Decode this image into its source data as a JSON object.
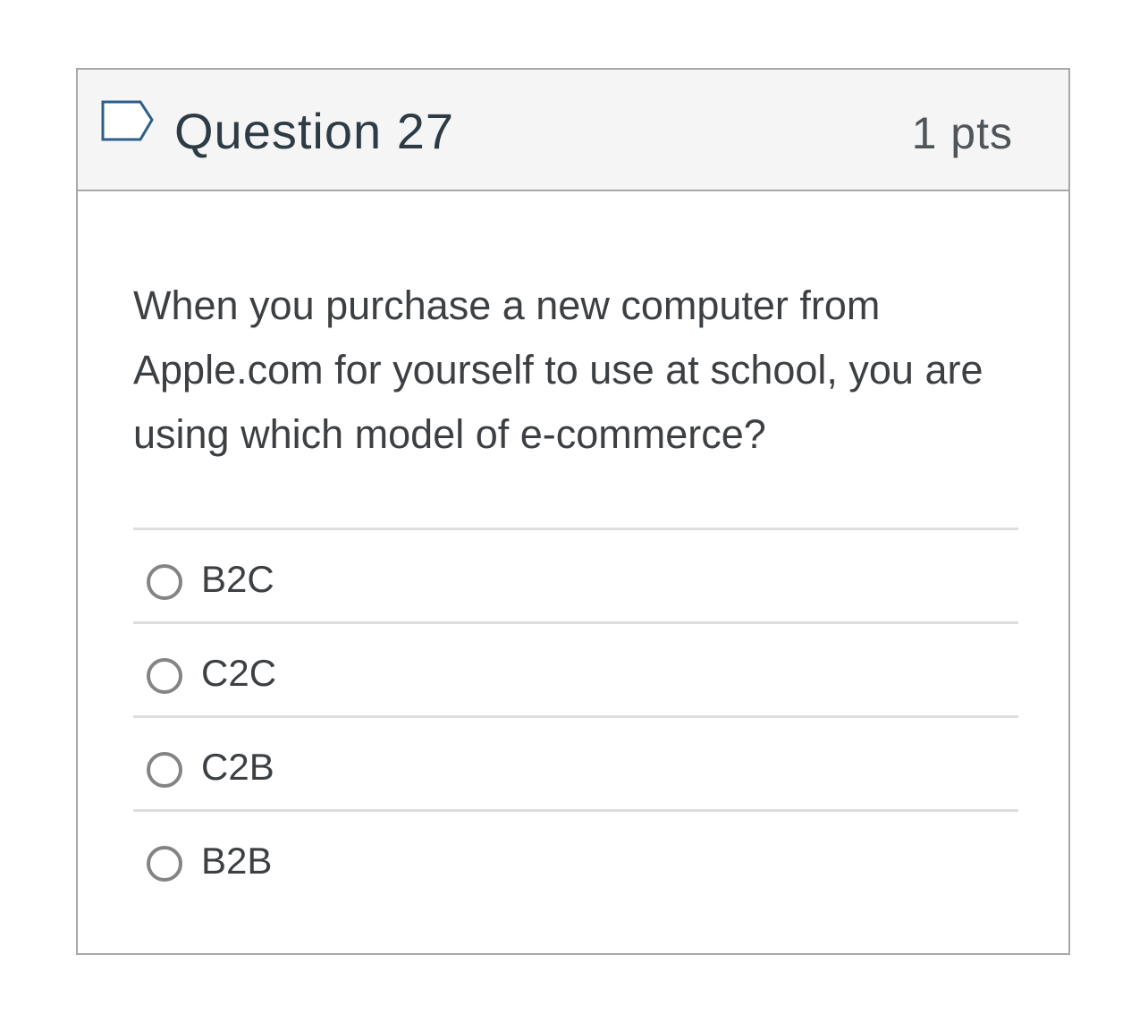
{
  "question": {
    "title": "Question 27",
    "points": "1 pts",
    "text": "When you purchase a new computer from Apple.com for yourself to use at school, you are using which model of e-commerce?",
    "flag_icon": "flag-icon",
    "answers": [
      {
        "label": "B2C",
        "selected": false
      },
      {
        "label": "C2C",
        "selected": false
      },
      {
        "label": "C2B",
        "selected": false
      },
      {
        "label": "B2B",
        "selected": false
      }
    ]
  },
  "colors": {
    "header_background": "#f5f5f5",
    "border": "#a8a8a8",
    "title_text": "#2d3b45",
    "body_text": "#3d4043",
    "radio_border": "#848484",
    "flag_outline": "#2d5f8a"
  }
}
